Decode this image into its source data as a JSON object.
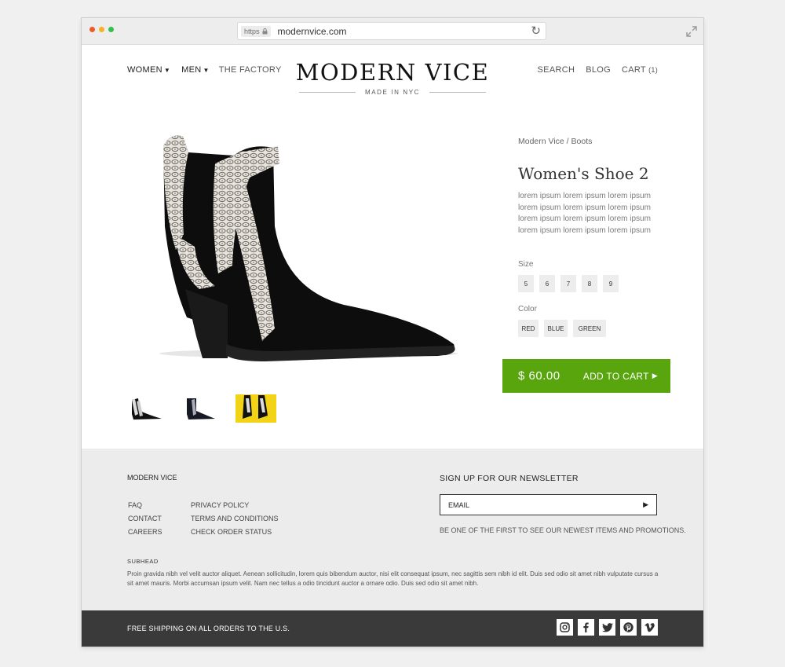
{
  "browser": {
    "https_label": "https",
    "url": "modernvice.com",
    "dot_colors": [
      "#ee5a2a",
      "#f5b324",
      "#33c14b"
    ]
  },
  "nav": {
    "women": "WOMEN",
    "men": "MEN",
    "factory": "THE FACTORY",
    "search": "SEARCH",
    "blog": "BLOG",
    "cart": "CART",
    "cart_count": "(1)"
  },
  "brand": {
    "title": "MODERN VICE",
    "tagline": "MADE IN NYC"
  },
  "product": {
    "breadcrumb": "Modern Vice / Boots",
    "title": "Women's Shoe 2",
    "description": "lorem ipsum lorem ipsum lorem ipsum lorem ipsum lorem ipsum lorem ipsum lorem ipsum lorem ipsum lorem ipsum lorem ipsum lorem ipsum lorem ipsum",
    "size_label": "Size",
    "sizes": [
      "5",
      "6",
      "7",
      "8",
      "9"
    ],
    "color_label": "Color",
    "colors": [
      "RED",
      "BLUE",
      "GREEN"
    ],
    "price": "$ 60.00",
    "add_to_cart": "ADD TO CART",
    "accent_color": "#58a50e"
  },
  "footer": {
    "brand": "MODERN VICE",
    "links_col1": [
      "FAQ",
      "CONTACT",
      "CAREERS"
    ],
    "links_col2": [
      "PRIVACY POLICY",
      "TERMS AND CONDITIONS",
      "CHECK ORDER STATUS"
    ],
    "newsletter_title": "SIGN UP FOR OUR NEWSLETTER",
    "email_placeholder": "EMAIL",
    "newsletter_note": "BE ONE OF THE FIRST TO SEE OUR NEWEST ITEMS AND PROMOTIONS.",
    "subhead": "SUBHEAD",
    "body": "Proin gravida nibh vel velit auctor aliquet. Aenean sollicitudin, lorem quis bibendum auctor, nisi elit consequat ipsum, nec sagittis sem nibh id elit. Duis sed odio sit amet nibh vulputate cursus a sit amet mauris. Morbi accumsan ipsum velit. Nam nec tellus a odio tincidunt auctor a ornare odio.  Duis sed odio sit amet nibh.",
    "shipping": "FREE SHIPPING ON ALL ORDERS TO THE U.S.",
    "social_icons": [
      "instagram-icon",
      "facebook-icon",
      "twitter-icon",
      "pinterest-icon",
      "vimeo-icon"
    ]
  }
}
